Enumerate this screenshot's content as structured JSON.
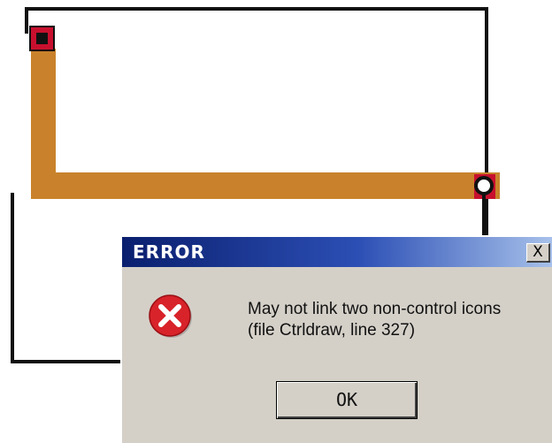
{
  "dialog": {
    "title": "ERROR",
    "close_label": "X",
    "message_line1": "May not link two non-control icons",
    "message_line2": "(file Ctrldraw, line 327)",
    "ok_label": "OK",
    "title_color_start": "#0a1f6e",
    "title_color_end": "#a7c1ea"
  },
  "diagram": {
    "pipe_color": "#c9822b",
    "node_color": "#c8102e",
    "wire_color": "#111111"
  }
}
